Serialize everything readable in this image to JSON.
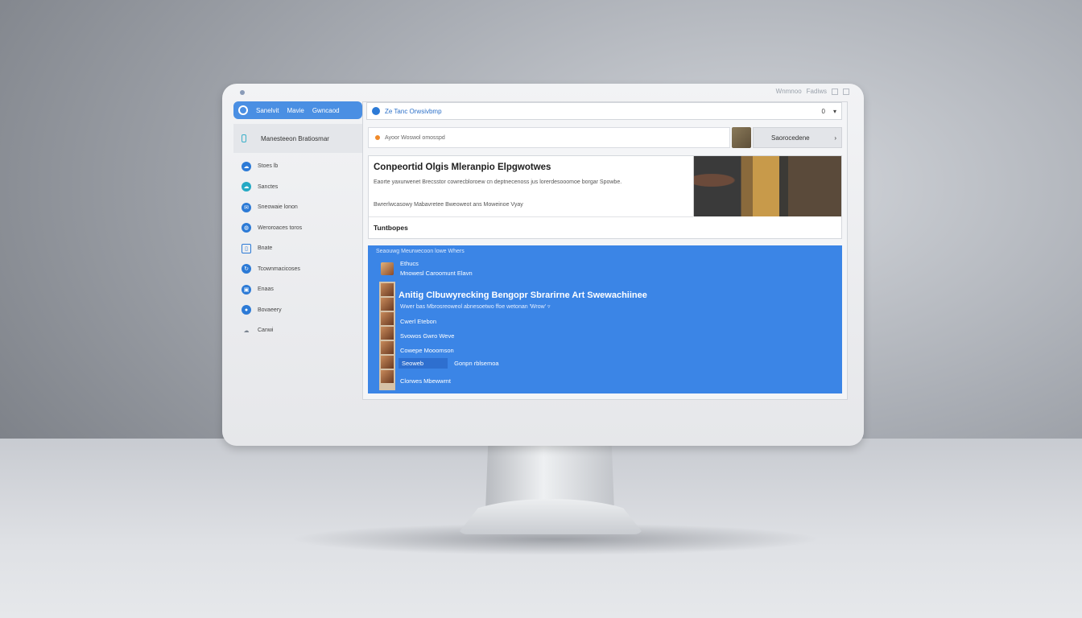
{
  "window": {
    "controls": [
      "Wnmnoo",
      "Fadiws"
    ]
  },
  "sidebar": {
    "top_tabs": [
      "Sanelvit",
      "Mavie",
      "Gwncaod"
    ],
    "header": "Manesteeon Bratiosmar",
    "items": [
      {
        "label": "Stoes lb",
        "icon": "cloud-icon",
        "style": "blue"
      },
      {
        "label": "Sanctes",
        "icon": "cloud-icon",
        "style": "teal"
      },
      {
        "label": "Sneowaie lonon",
        "icon": "chat-icon",
        "style": "blue"
      },
      {
        "label": "Weroroaces toros",
        "icon": "globe-icon",
        "style": "blue"
      },
      {
        "label": "Bnate",
        "icon": "doc-icon",
        "style": "sq"
      },
      {
        "label": "Tcownmacicoses",
        "icon": "refresh-icon",
        "style": "blue"
      },
      {
        "label": "Enaas",
        "icon": "image-icon",
        "style": "blue"
      },
      {
        "label": "Bovaeery",
        "icon": "user-icon",
        "style": "blue"
      },
      {
        "label": "Canwi",
        "icon": "cloud-outline-icon",
        "style": "grey"
      }
    ]
  },
  "urlbar": {
    "text": "Ze Tanc Orwsivbmp",
    "right_a": "0",
    "right_b": "▾"
  },
  "search": {
    "placeholder": "Ayoor Woswol omosspd",
    "button_label": "Saorocedene"
  },
  "article": {
    "title": "Conpeortid Olgis Mleranpio Elpgwotwes",
    "description": "Eaorte yaxurwenet Brecsstor cowrecbloroew cn deptnecenoss jus lorerdesooomoe borgar Spowbe.",
    "meta": "Bwrerlwcasowy Mabavretee Bweoweot ans Moweinoe Vyay",
    "section": "Tuntbopes"
  },
  "panel": {
    "top": "Seaouwg Meurwecoon lowe Whers",
    "row1_title": "Ethucs",
    "row1_sub": "Mnowesl Caroomunt Elavn",
    "headline": "Anitig Clbuwyrecking Bengopr Sbrarirne Art Swewachiinee",
    "headline_sub": "Wwer bas Mbrosreoweol abnesoetwo ffoe wetonan 'Wrow' ▿",
    "rows": [
      "Cwerl Etebon",
      "Svowos Gwro Weve",
      "Cowepe Mooomson"
    ],
    "selected": "Seoweb",
    "selected_tail": "Gonpn rblsemoa",
    "last": "Clorwes Mbewwmt"
  }
}
